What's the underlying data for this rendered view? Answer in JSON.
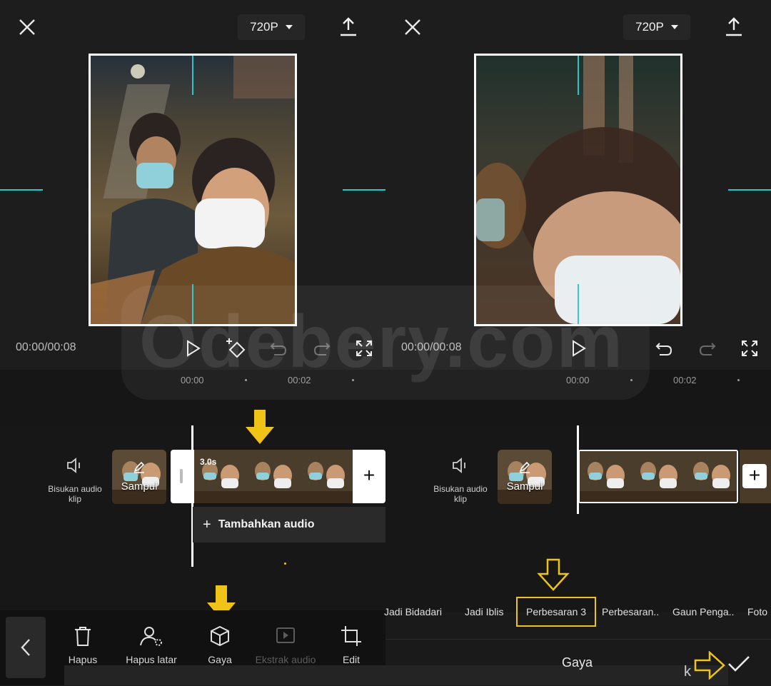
{
  "left_panel": {
    "resolution": "720P",
    "time": "00:00/00:08",
    "ticks": [
      "00:00",
      "00:02"
    ],
    "mute_label": "Bisukan audio klip",
    "cover_label": "Sampul",
    "clip_duration": "3.0s",
    "add_audio": "Tambahkan audio",
    "toolbar": [
      {
        "label": "Hapus",
        "icon": "trash-icon",
        "enabled": true
      },
      {
        "label": "Hapus latar",
        "icon": "remove-background-icon",
        "enabled": true
      },
      {
        "label": "Gaya",
        "icon": "cube-icon",
        "enabled": true
      },
      {
        "label": "Ekstrak audio",
        "icon": "extract-audio-icon",
        "enabled": false
      },
      {
        "label": "Edit",
        "icon": "crop-icon",
        "enabled": true
      }
    ]
  },
  "right_panel": {
    "resolution": "720P",
    "time": "00:00/00:08",
    "ticks": [
      "00:00",
      "00:02"
    ],
    "mute_label": "Bisukan audio klip",
    "cover_label": "Sampul",
    "styles": [
      "Jadi Bidadari",
      "Jadi Iblis",
      "Perbesaran 3",
      "Perbesaran..",
      "Gaun Penga..",
      "Foto"
    ],
    "selected_style": "Perbesaran 3",
    "panel_title": "Gaya",
    "partial_text": "k"
  },
  "watermark": "Odebery.com",
  "colors": {
    "accent_cyan": "#27c6cf",
    "annotation_yellow": "#f0c417",
    "background": "#1a1a1a"
  }
}
